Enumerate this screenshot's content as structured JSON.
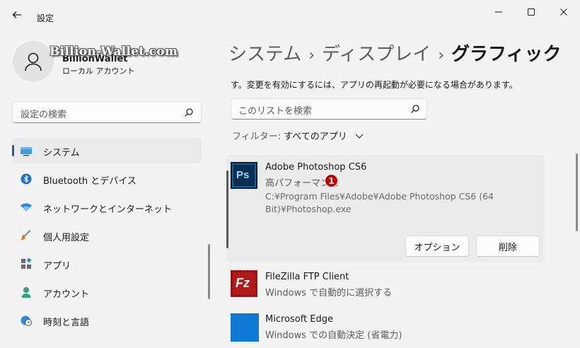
{
  "window": {
    "title": "設定",
    "controls": [
      "minimize",
      "maximize",
      "close"
    ]
  },
  "user": {
    "name": "BillionWallet",
    "account_type": "ローカル アカウント",
    "watermark": "Billion-Wallet.com"
  },
  "sidebar": {
    "search_placeholder": "設定の検索",
    "items": [
      {
        "label": "システム",
        "icon": "monitor-icon",
        "active": true
      },
      {
        "label": "Bluetooth とデバイス",
        "icon": "bluetooth-icon"
      },
      {
        "label": "ネットワークとインターネット",
        "icon": "wifi-icon"
      },
      {
        "label": "個人用設定",
        "icon": "brush-icon"
      },
      {
        "label": "アプリ",
        "icon": "apps-icon"
      },
      {
        "label": "アカウント",
        "icon": "person-icon"
      },
      {
        "label": "時刻と言語",
        "icon": "globe-clock-icon"
      }
    ]
  },
  "breadcrumb": {
    "items": [
      "システム",
      "ディスプレイ"
    ],
    "separator": "›",
    "current": "グラフィック"
  },
  "description": "す。変更を有効にするには、アプリの再起動が必要になる場合があります。",
  "list_search": {
    "placeholder": "このリストを検索"
  },
  "filter": {
    "label": "フィルター:",
    "value": "すべてのアプリ"
  },
  "apps": [
    {
      "name": "Adobe Photoshop CS6",
      "preference": "高パフォーマンス",
      "path": "C:¥Program Files¥Adobe¥Adobe Photoshop CS6 (64 Bit)¥Photoshop.exe",
      "icon": "photoshop-icon",
      "icon_text": "Ps",
      "expanded": true,
      "badge": "1",
      "options_label": "オプション",
      "remove_label": "削除"
    },
    {
      "name": "FileZilla FTP Client",
      "preference": "Windows で自動的に選択する",
      "icon": "filezilla-icon",
      "icon_text": "Fz"
    },
    {
      "name": "Microsoft Edge",
      "preference": "Windows での自動決定 (省電力)",
      "icon": "edge-icon"
    }
  ],
  "colors": {
    "background": "#f3f3f3",
    "accent": "#1f5fa8",
    "badge": "#c00000",
    "card": "#ebebeb"
  }
}
